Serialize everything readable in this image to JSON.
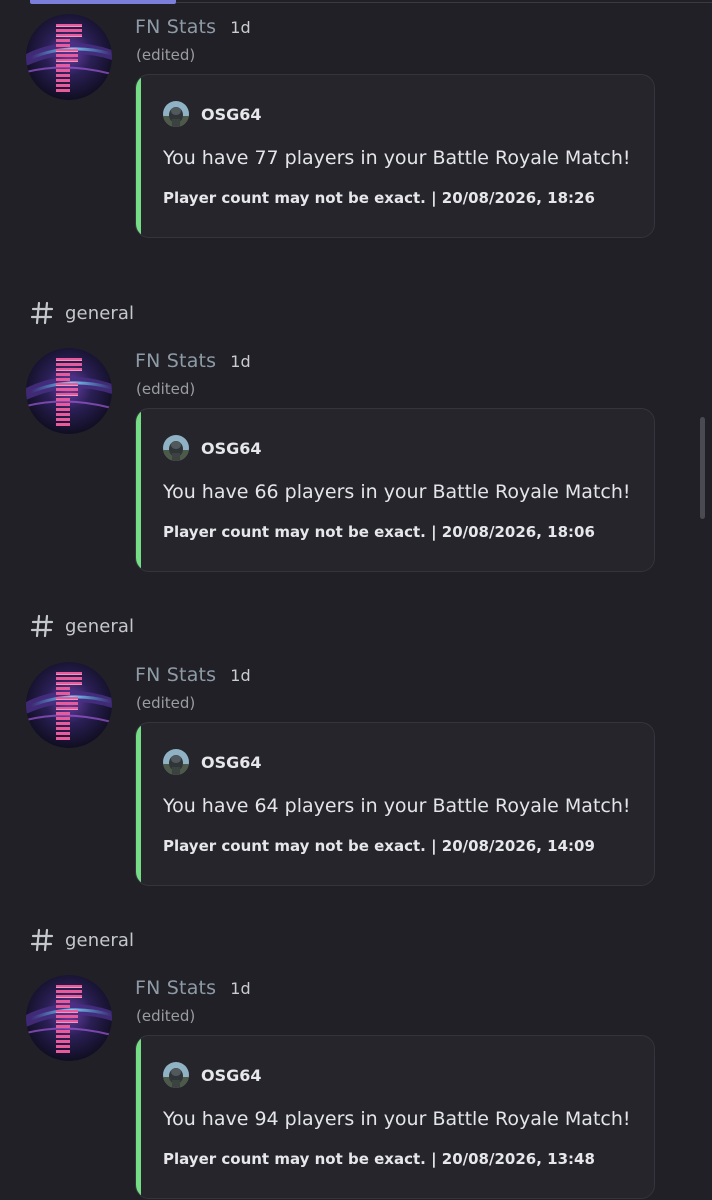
{
  "colors": {
    "background": "#202026",
    "embed_background": "#25252b",
    "embed_accent": "#74dd86",
    "author_name": "#8e9ba6",
    "top_indicator": "#7b7fd9"
  },
  "icons": {
    "channel": "hash-icon",
    "bot_avatar": "fn-stats-avatar",
    "embed_author": "osg64-avatar"
  },
  "channels": [
    {
      "name": "general"
    },
    {
      "name": "general"
    },
    {
      "name": "general"
    }
  ],
  "messages": [
    {
      "author": "FN Stats",
      "time": "1d",
      "edited": "(edited)",
      "embed": {
        "author": "OSG64",
        "description": "You have 77 players in your Battle Royale Match!",
        "footer": "Player count may not be exact. | 20/08/2026, 18:26"
      }
    },
    {
      "author": "FN Stats",
      "time": "1d",
      "edited": "(edited)",
      "embed": {
        "author": "OSG64",
        "description": "You have 66 players in your Battle Royale Match!",
        "footer": "Player count may not be exact. | 20/08/2026, 18:06"
      }
    },
    {
      "author": "FN Stats",
      "time": "1d",
      "edited": "(edited)",
      "embed": {
        "author": "OSG64",
        "description": "You have 64 players in your Battle Royale Match!",
        "footer": "Player count may not be exact. | 20/08/2026, 14:09"
      }
    },
    {
      "author": "FN Stats",
      "time": "1d",
      "edited": "(edited)",
      "embed": {
        "author": "OSG64",
        "description": "You have 94 players in your Battle Royale Match!",
        "footer": "Player count may not be exact. | 20/08/2026, 13:48"
      }
    }
  ]
}
